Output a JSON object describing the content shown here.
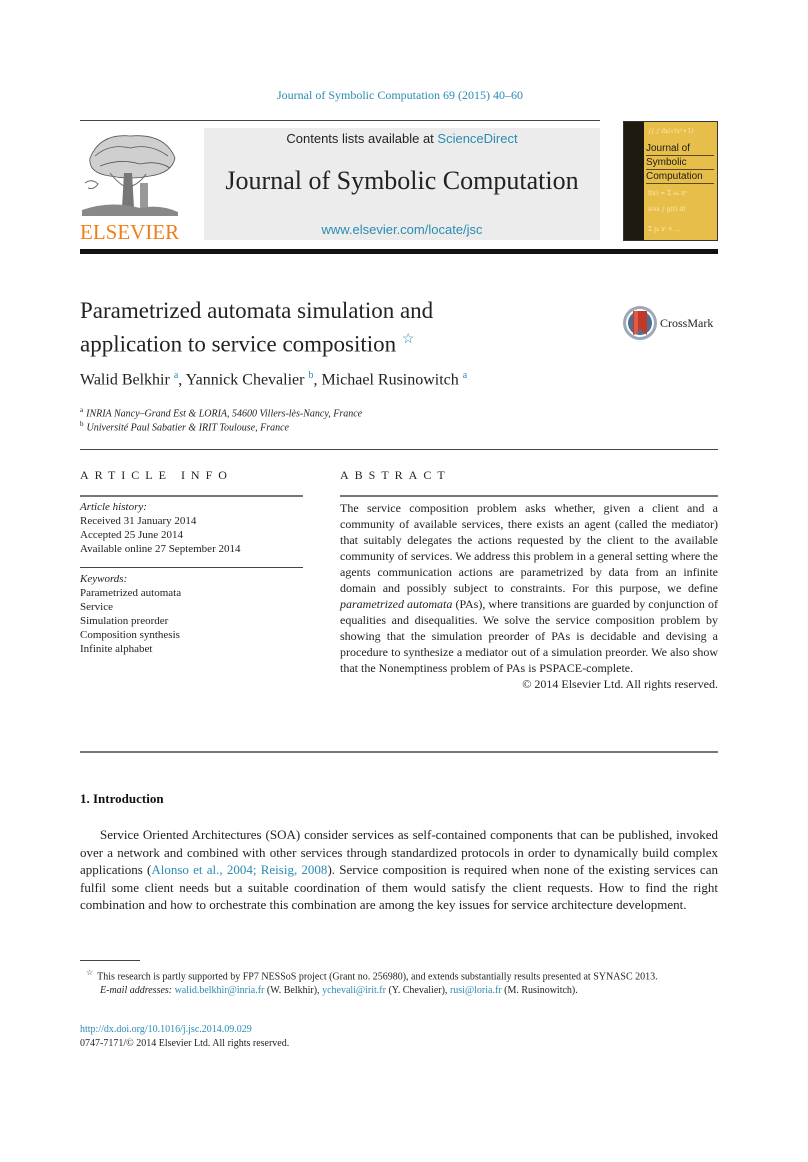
{
  "header": {
    "journal_reference": "Journal of Symbolic Computation 69 (2015) 40–60",
    "contents_prefix": "Contents lists available at ",
    "contents_link": "ScienceDirect",
    "journal_title": "Journal of Symbolic Computation",
    "journal_url": "www.elsevier.com/locate/jsc",
    "publisher_logo_text": "ELSEVIER",
    "cover": {
      "lines": [
        "Journal of",
        "Symbolic",
        "Computation"
      ],
      "color": "#e8be4a"
    },
    "colors": {
      "link": "#2a8bb3",
      "elsevier_orange": "#f07f1a"
    }
  },
  "article": {
    "title_line1": "Parametrized automata simulation and",
    "title_line2": "application to service composition",
    "title_star": "☆",
    "crossmark_label": "CrossMark",
    "authors": [
      {
        "name": "Walid Belkhir",
        "aff": "a"
      },
      {
        "name": "Yannick Chevalier",
        "aff": "b"
      },
      {
        "name": "Michael Rusinowitch",
        "aff": "a"
      }
    ],
    "author_separator": ", ",
    "affiliations": [
      {
        "tag": "a",
        "text": "INRIA Nancy–Grand Est & LORIA, 54600 Villers-lès-Nancy, France"
      },
      {
        "tag": "b",
        "text": "Université Paul Sabatier & IRIT Toulouse, France"
      }
    ]
  },
  "article_info": {
    "heading": "ARTICLE INFO",
    "history_label": "Article history:",
    "history": [
      "Received 31 January 2014",
      "Accepted 25 June 2014",
      "Available online 27 September 2014"
    ],
    "keywords_label": "Keywords:",
    "keywords": [
      "Parametrized automata",
      "Service",
      "Simulation preorder",
      "Composition synthesis",
      "Infinite alphabet"
    ]
  },
  "abstract": {
    "heading": "ABSTRACT",
    "text_before_italic": "The service composition problem asks whether, given a client and a community of available services, there exists an agent (called the mediator) that suitably delegates the actions requested by the client to the available community of services. We address this problem in a general setting where the agents communication actions are parametrized by data from an infinite domain and possibly subject to constraints. For this purpose, we define ",
    "italic": "parametrized automata",
    "text_after_italic": " (PAs), where transitions are guarded by conjunction of equalities and disequalities. We solve the service composition problem by showing that the simulation preorder of PAs is decidable and devising a procedure to synthesize a mediator out of a simulation preorder. We also show that the Nonemptiness problem of PAs is PSPACE-complete.",
    "copyright": "© 2014 Elsevier Ltd. All rights reserved."
  },
  "introduction": {
    "heading": "1. Introduction",
    "text_before_citation": "Service Oriented Architectures (SOA) consider services as self-contained components that can be published, invoked over a network and combined with other services through standardized protocols in order to dynamically build complex applications (",
    "citations": [
      "Alonso et al., 2004",
      "Reisig, 2008"
    ],
    "citation_separator": "; ",
    "text_after_citation": "). Service composition is required when none of the existing services can fulfil some client needs but a suitable coordination of them would satisfy the client requests. How to find the right combination and how to orchestrate this combination are among the key issues for service architecture development."
  },
  "footnotes": {
    "star": "☆",
    "funding": "This research is partly supported by FP7 NESSoS project (Grant no. 256980), and extends substantially results presented at SYNASC 2013.",
    "email_label": "E-mail addresses:",
    "emails": [
      {
        "email": "walid.belkhir@inria.fr",
        "owner": " (W. Belkhir), "
      },
      {
        "email": "ychevali@irit.fr",
        "owner": " (Y. Chevalier), "
      },
      {
        "email": "rusi@loria.fr",
        "owner": " (M. Rusinowitch)."
      }
    ]
  },
  "doi": "http://dx.doi.org/10.1016/j.jsc.2014.09.029",
  "issn_line": "0747-7171/© 2014 Elsevier Ltd. All rights reserved."
}
